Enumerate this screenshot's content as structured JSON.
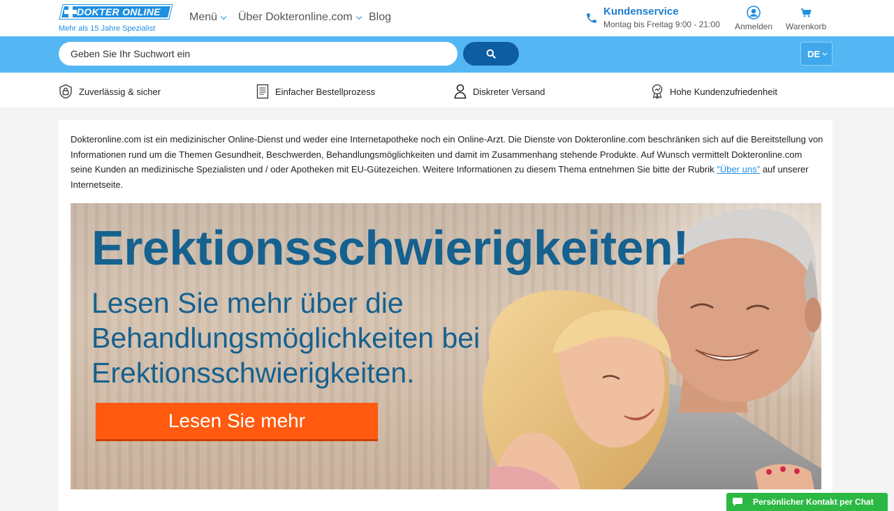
{
  "header": {
    "logo_text": "DOKTER ONLINE",
    "tagline": "Mehr als 15 Jahre Spezialist",
    "nav": {
      "menu": "Menü",
      "about": "Über Dokteronline.com",
      "blog": "Blog"
    },
    "customer_service": {
      "title": "Kundenservice",
      "hours": "Montag bis Freitag 9:00 - 21:00"
    },
    "login_label": "Anmelden",
    "cart_label": "Warenkorb"
  },
  "search": {
    "placeholder": "Geben Sie Ihr Suchwort ein",
    "language": "DE"
  },
  "usps": [
    {
      "label": "Zuverlässig & sicher",
      "icon": "lock-icon"
    },
    {
      "label": "Einfacher Bestellprozess",
      "icon": "document-icon"
    },
    {
      "label": "Diskreter Versand",
      "icon": "person-icon"
    },
    {
      "label": "Hohe Kundenzufriedenheit",
      "icon": "award-icon"
    }
  ],
  "disclaimer": {
    "text": "Dokteronline.com ist ein medizinischer Online-Dienst und weder eine Internetapotheke noch ein Online-Arzt. Die Dienste von Dokteronline.com beschränken sich auf die Bereitstellung von Informationen rund um die Themen Gesundheit, Beschwerden, Behandlungsmöglichkeiten und damit im Zusammenhang stehende Produkte. Auf Wunsch vermittelt Dokteronline.com seine Kunden an medizinische Spezialisten und / oder Apotheken mit EU-Gütezeichen. Weitere Informationen zu diesem Thema entnehmen Sie bitte der Rubrik ",
    "link": "\"Über uns\"",
    "suffix": " auf unserer Internetseite."
  },
  "banner": {
    "headline": "Erektionsschwierigkeiten!",
    "subline": "Lesen Sie mehr über die Behandlungsmöglichkeiten bei Erektionsschwierigkeiten.",
    "cta": "Lesen Sie mehr"
  },
  "chat": {
    "label": "Persönlicher Kontakt per Chat"
  },
  "colors": {
    "brand_blue": "#1f8fe0",
    "search_bar": "#55b6f4",
    "search_button": "#0e5da3",
    "cta_orange": "#ff5a10",
    "chat_green": "#2bb843",
    "banner_text": "#15618f"
  }
}
